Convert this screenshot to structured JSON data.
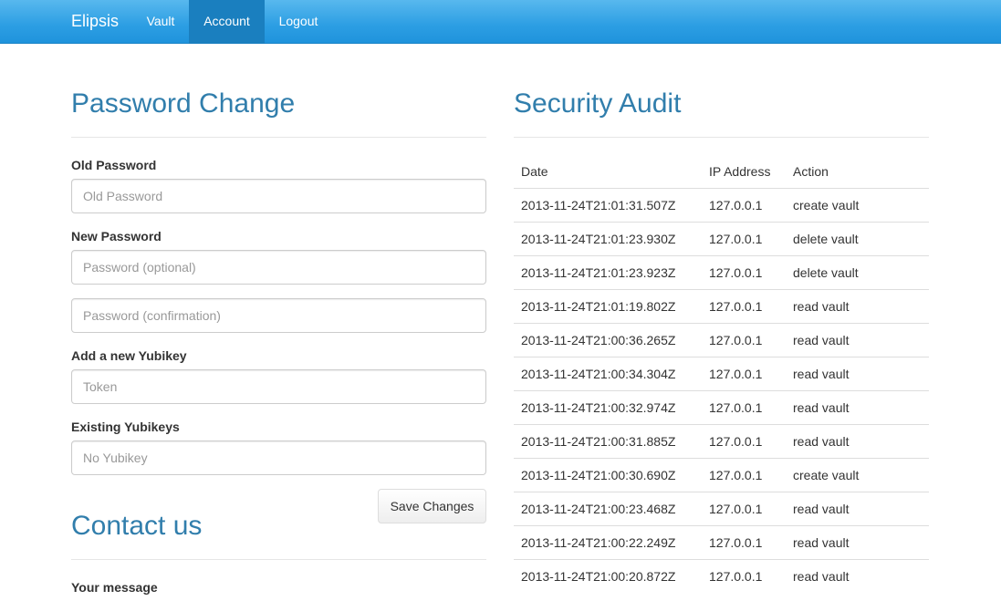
{
  "nav": {
    "brand": "Elipsis",
    "items": [
      {
        "label": "Vault"
      },
      {
        "label": "Account",
        "active": true
      },
      {
        "label": "Logout"
      }
    ]
  },
  "password_change": {
    "title": "Password Change",
    "old_password_label": "Old Password",
    "old_password_placeholder": "Old Password",
    "new_password_label": "New Password",
    "new_password_placeholder": "Password (optional)",
    "confirm_placeholder": "Password (confirmation)",
    "add_yubikey_label": "Add a new Yubikey",
    "token_placeholder": "Token",
    "existing_yubikeys_label": "Existing Yubikeys",
    "existing_yubikeys_placeholder": "No Yubikey",
    "save_label": "Save Changes"
  },
  "contact": {
    "title": "Contact us",
    "message_label": "Your message"
  },
  "audit": {
    "title": "Security Audit",
    "columns": [
      "Date",
      "IP Address",
      "Action"
    ],
    "rows": [
      [
        "2013-11-24T21:01:31.507Z",
        "127.0.0.1",
        "create vault"
      ],
      [
        "2013-11-24T21:01:23.930Z",
        "127.0.0.1",
        "delete vault"
      ],
      [
        "2013-11-24T21:01:23.923Z",
        "127.0.0.1",
        "delete vault"
      ],
      [
        "2013-11-24T21:01:19.802Z",
        "127.0.0.1",
        "read vault"
      ],
      [
        "2013-11-24T21:00:36.265Z",
        "127.0.0.1",
        "read vault"
      ],
      [
        "2013-11-24T21:00:34.304Z",
        "127.0.0.1",
        "read vault"
      ],
      [
        "2013-11-24T21:00:32.974Z",
        "127.0.0.1",
        "read vault"
      ],
      [
        "2013-11-24T21:00:31.885Z",
        "127.0.0.1",
        "read vault"
      ],
      [
        "2013-11-24T21:00:30.690Z",
        "127.0.0.1",
        "create vault"
      ],
      [
        "2013-11-24T21:00:23.468Z",
        "127.0.0.1",
        "read vault"
      ],
      [
        "2013-11-24T21:00:22.249Z",
        "127.0.0.1",
        "read vault"
      ],
      [
        "2013-11-24T21:00:20.872Z",
        "127.0.0.1",
        "read vault"
      ]
    ]
  },
  "colors": {
    "navbar": "#2c9ee3",
    "nav_active": "#1a7fbf",
    "heading": "#317eac"
  }
}
